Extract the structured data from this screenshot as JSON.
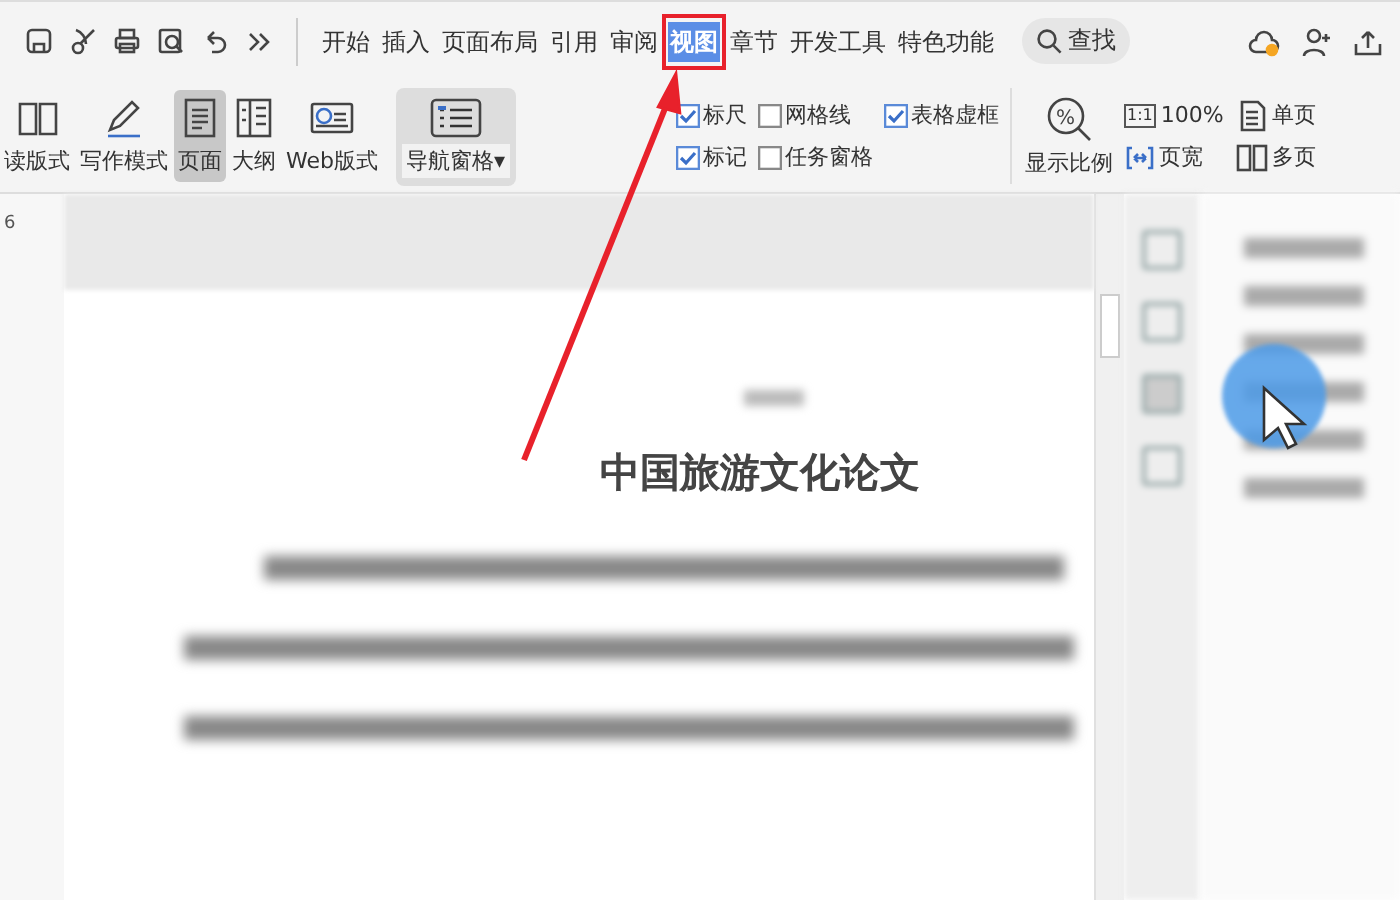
{
  "tabs": [
    {
      "label": "开始",
      "selected": false
    },
    {
      "label": "插入",
      "selected": false
    },
    {
      "label": "页面布局",
      "selected": false
    },
    {
      "label": "引用",
      "selected": false
    },
    {
      "label": "审阅",
      "selected": false
    },
    {
      "label": "视图",
      "selected": true
    },
    {
      "label": "章节",
      "selected": false
    },
    {
      "label": "开发工具",
      "selected": false
    },
    {
      "label": "特色功能",
      "selected": false
    }
  ],
  "search": {
    "label": "查找"
  },
  "view_modes": [
    {
      "label": "读版式",
      "selected": false
    },
    {
      "label": "写作模式",
      "selected": false
    },
    {
      "label": "页面",
      "selected": true
    },
    {
      "label": "大纲",
      "selected": false
    },
    {
      "label": "Web版式",
      "selected": false
    }
  ],
  "nav_pane": {
    "label": "导航窗格",
    "caret": "▾"
  },
  "checkboxes": [
    {
      "label": "标尺",
      "checked": true
    },
    {
      "label": "网格线",
      "checked": false
    },
    {
      "label": "表格虚框",
      "checked": true
    },
    {
      "label": "标记",
      "checked": true
    },
    {
      "label": "任务窗格",
      "checked": false
    }
  ],
  "zoom": {
    "label": "显示比例",
    "icon_text": "%"
  },
  "zoom_options": [
    {
      "label": "100%",
      "icon_text": "1:1"
    },
    {
      "label": "单页"
    },
    {
      "label": "页宽"
    },
    {
      "label": "多页"
    }
  ],
  "ruler": {
    "left_mark": "6"
  },
  "document": {
    "title": "中国旅游文化论文"
  }
}
